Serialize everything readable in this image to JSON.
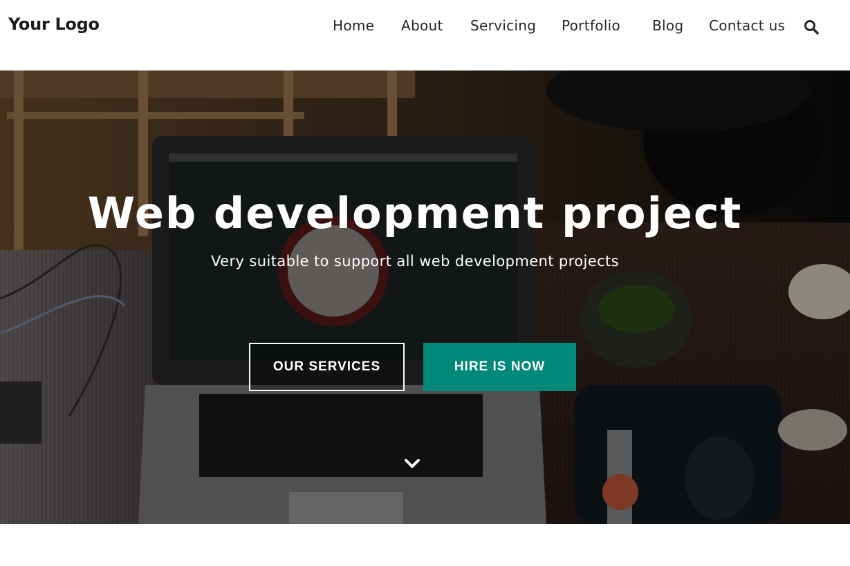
{
  "header": {
    "logo": "Your Logo",
    "nav": [
      "Home",
      "About",
      "Servicing",
      "Portfolio",
      "Blog",
      "Contact us"
    ],
    "search_icon": "search-icon"
  },
  "hero": {
    "title": "Web development project",
    "subtitle": "Very suitable to support all web development projects",
    "primary_button": "OUR SERVICES",
    "secondary_button": "HIRE IS NOW",
    "scroll_icon": "chevron-down-icon",
    "background": "desk-with-laptop-photo"
  },
  "colors": {
    "accent": "#008878",
    "text_dark": "#262626",
    "white": "#ffffff"
  }
}
